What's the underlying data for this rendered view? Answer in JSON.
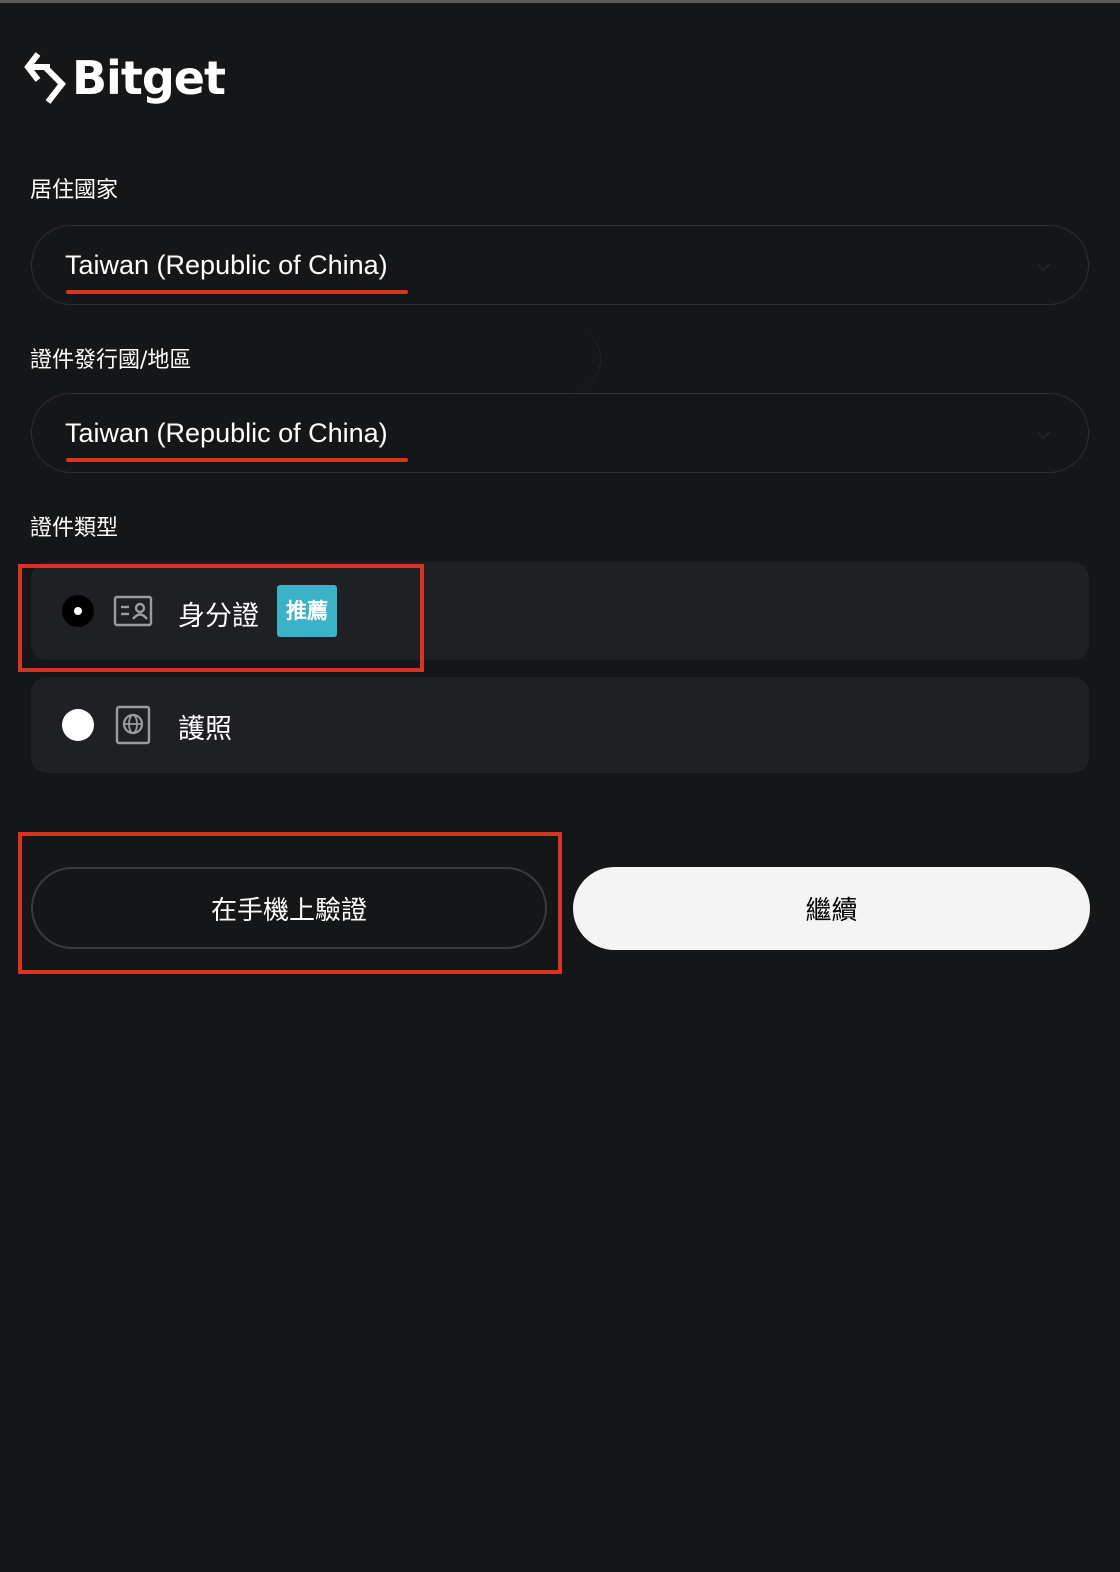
{
  "brand": {
    "name": "Bitget",
    "logo_icon": "bitget-logo-icon"
  },
  "form": {
    "residence": {
      "label": "居住國家",
      "value": "Taiwan (Republic of China)"
    },
    "issuing_country": {
      "label": "證件發行國/地區",
      "value": "Taiwan (Republic of China)"
    },
    "document_type": {
      "label": "證件類型",
      "options": [
        {
          "label": "身分證",
          "badge": "推薦",
          "icon": "id-card-icon",
          "selected": true
        },
        {
          "label": "護照",
          "icon": "passport-icon",
          "selected": false
        }
      ]
    }
  },
  "actions": {
    "verify_on_phone": "在手機上驗證",
    "continue": "繼續"
  },
  "colors": {
    "background": "#151617",
    "card": "#1e2023",
    "badge": "#3bb2c8",
    "annotation": "#d8341f",
    "primary_button": "#f4f4f5"
  }
}
